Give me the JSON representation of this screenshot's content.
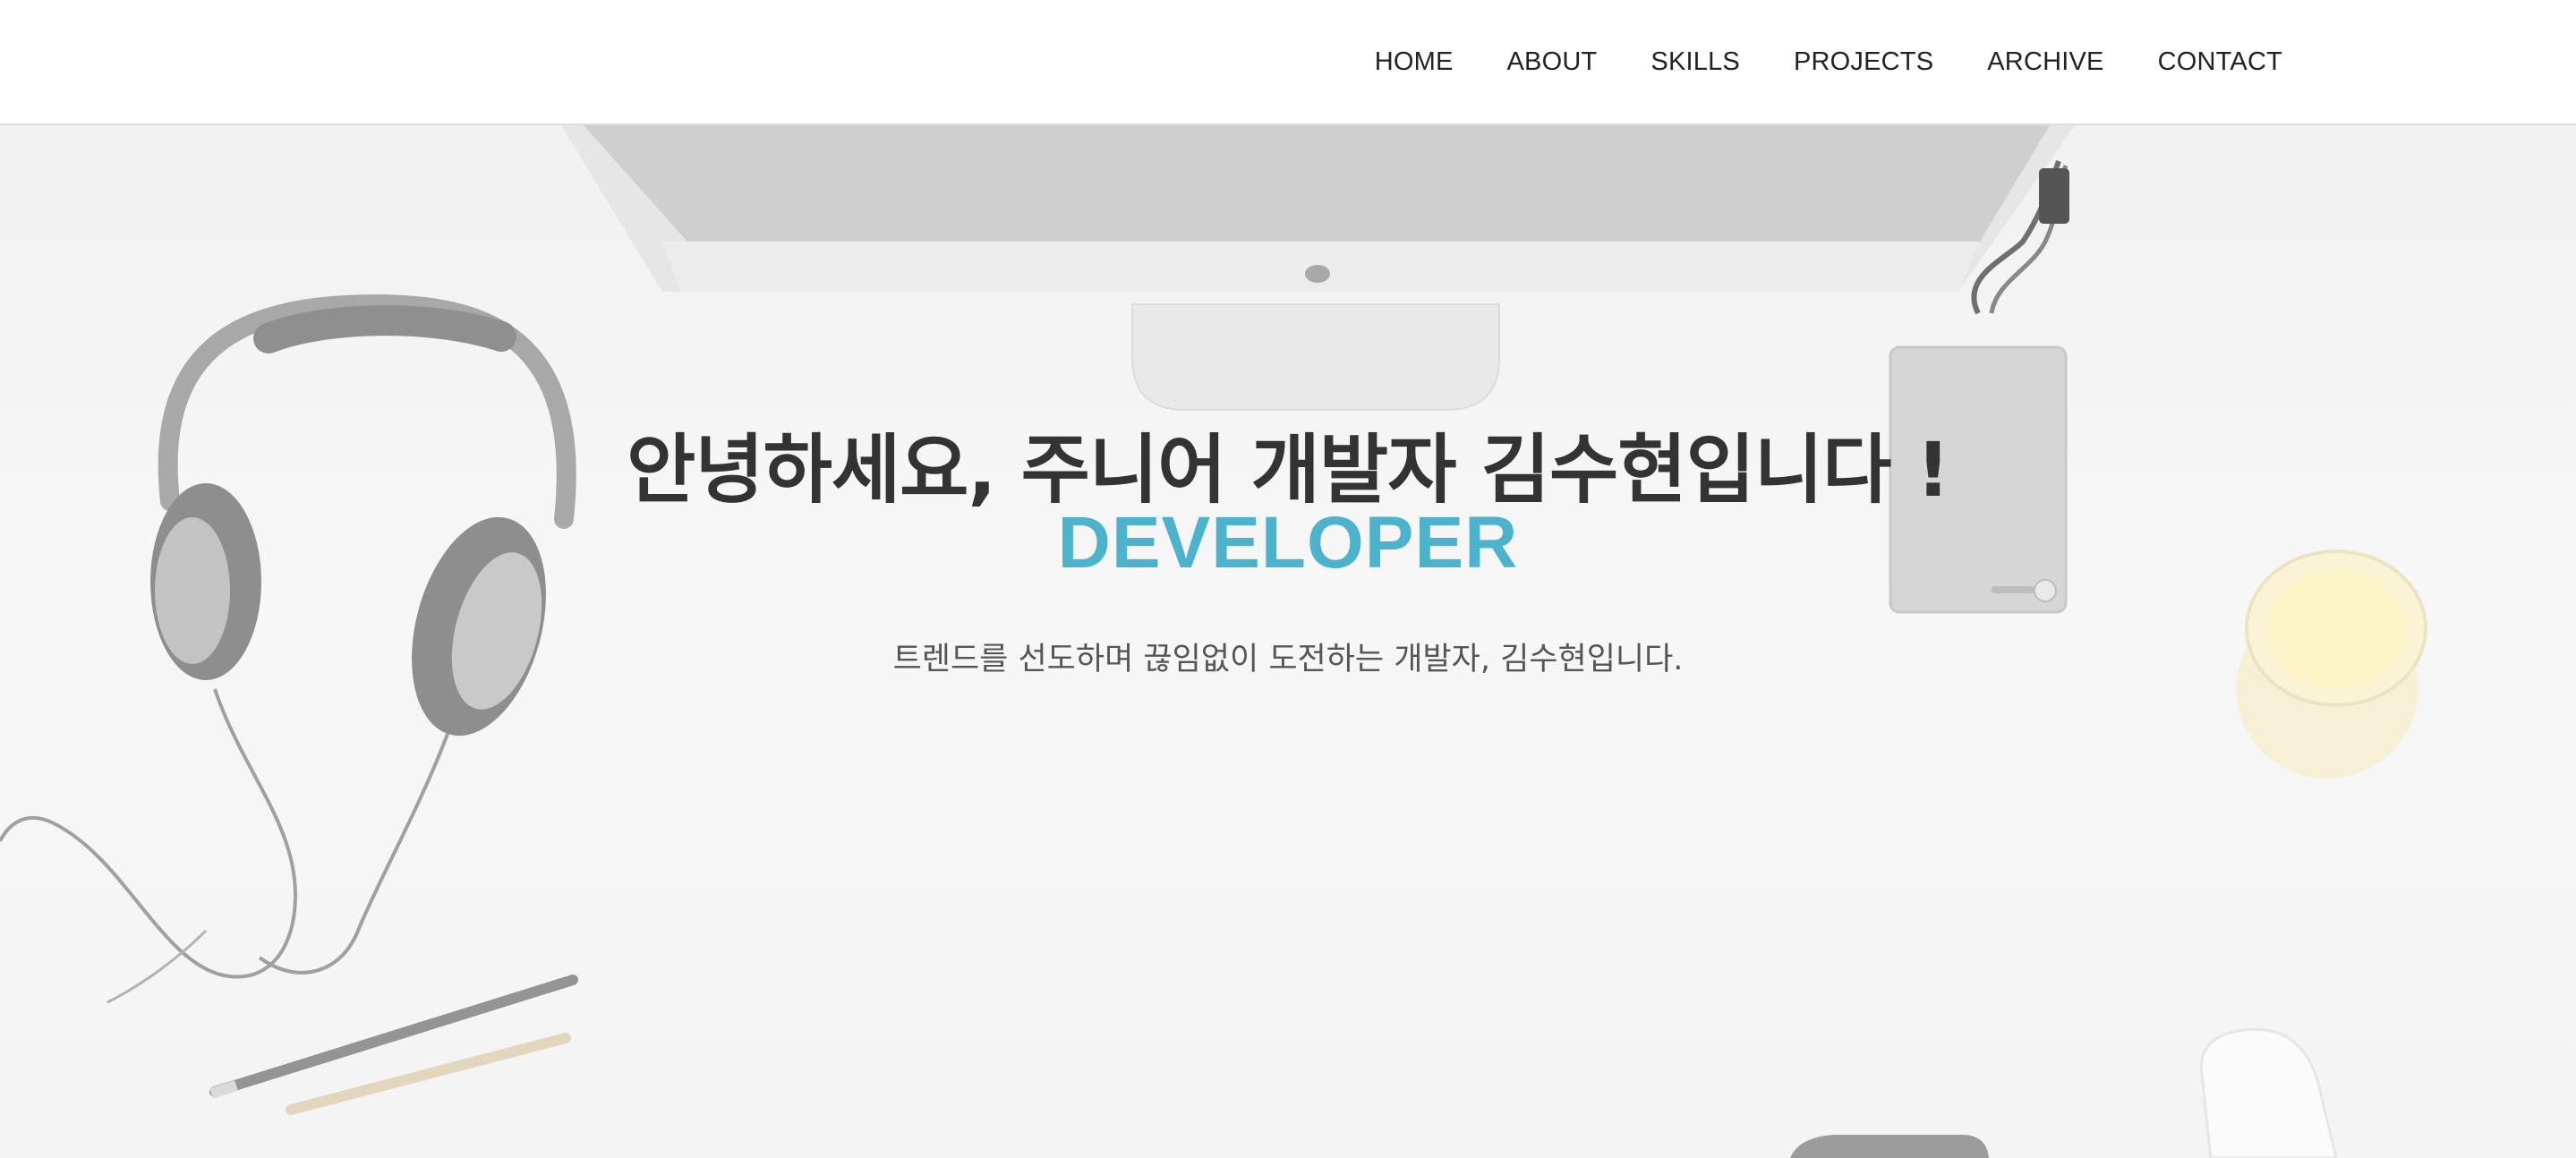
{
  "nav": {
    "items": [
      {
        "label": "HOME"
      },
      {
        "label": "ABOUT"
      },
      {
        "label": "SKILLS"
      },
      {
        "label": "PROJECTS"
      },
      {
        "label": "ARCHIVE"
      },
      {
        "label": "CONTACT"
      }
    ]
  },
  "hero": {
    "greeting": "안녕하세요, 주니어 개발자 김수현입니다 !",
    "role": "DEVELOPER",
    "tagline": "트렌드를 선도하며 끊임없이 도전하는 개발자, 김수현입니다."
  },
  "colors": {
    "accent": "#4db3cc",
    "heading": "#333333",
    "nav_text": "#222222",
    "background": "#f3f3f3"
  }
}
